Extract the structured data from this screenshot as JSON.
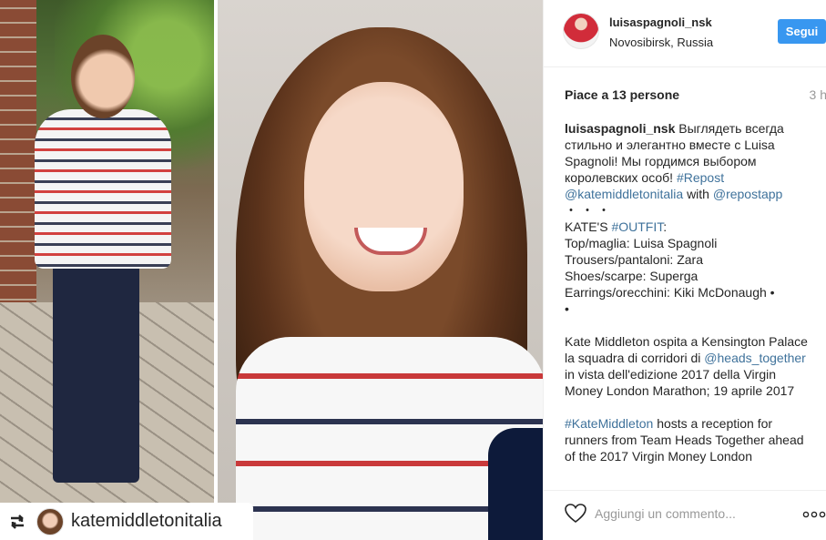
{
  "repost": {
    "badge_name": "katemiddletonitalia",
    "icon": "repost-icon"
  },
  "post": {
    "username": "luisaspagnoli_nsk",
    "location": "Novosibirsk, Russia",
    "follow_label": "Segui",
    "likes_text": "Piace a 13 persone",
    "time_ago": "3 h",
    "caption": {
      "author": "luisaspagnoli_nsk",
      "intro": "Выглядеть всегда стильно и элегантно вместе с Luisa Spagnoli! Мы гордимся выбором королевских особ!",
      "hashtag_repost": "#Repost",
      "mention_source": "@katemiddletonitalia",
      "with_word": "with",
      "mention_app": "@repostapp",
      "dots": "・・・",
      "kates_prefix": "KATE'S",
      "hashtag_outfit": "#OUTFIT",
      "kates_suffix": ":",
      "top": "Top/maglia: Luisa Spagnoli",
      "trousers": "Trousers/pantaloni: Zara",
      "shoes": "Shoes/scarpe: Superga",
      "earrings": "Earrings/orecchini: Kiki McDonaugh •",
      "bullet": "•",
      "para2_a": "Kate Middleton ospita a Kensington Palace la squadra di corridori di",
      "mention_heads": "@heads_together",
      "para2_b": "in vista dell'edizione 2017 della Virgin Money London Marathon; 19 aprile 2017",
      "hashtag_kate": "#KateMiddleton",
      "para3": "hosts a reception for runners from Team Heads Together ahead of the 2017 Virgin Money London"
    },
    "comment_placeholder": "Aggiungi un commento...",
    "icons": {
      "like": "heart-icon",
      "more": "more-options-icon",
      "avatar": "avatar"
    },
    "colors": {
      "follow_button": "#3897f0",
      "link": "#3f729b"
    }
  }
}
